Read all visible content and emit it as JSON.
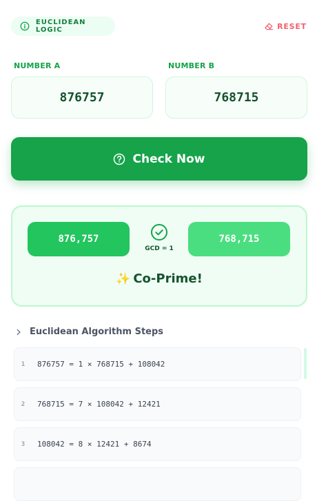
{
  "header": {
    "badge_label": "EUCLIDEAN LOGIC",
    "badge_icon": "info-icon",
    "reset_label": "RESET",
    "reset_icon": "eraser-icon"
  },
  "inputs": {
    "a_label": "NUMBER A",
    "a_value": "876757",
    "b_label": "NUMBER B",
    "b_value": "768715"
  },
  "action": {
    "check_label": "Check Now",
    "check_icon": "question-circle-icon"
  },
  "result": {
    "a_display": "876,757",
    "b_display": "768,715",
    "gcd_text": "GCD = 1",
    "verdict_emoji": "✨",
    "verdict_text": "Co-Prime!"
  },
  "steps": {
    "title": "Euclidean Algorithm Steps",
    "items": [
      {
        "index": "1",
        "equation": "876757 = 1 × 768715 + 108042"
      },
      {
        "index": "2",
        "equation": "768715 = 7 × 108042 + 12421"
      },
      {
        "index": "3",
        "equation": "108042 = 8 × 12421 + 8674"
      }
    ]
  },
  "colors": {
    "accent": "#16a34a",
    "accent_light": "#4ade80",
    "danger": "#f0616d",
    "card_bg": "#effdf4"
  }
}
